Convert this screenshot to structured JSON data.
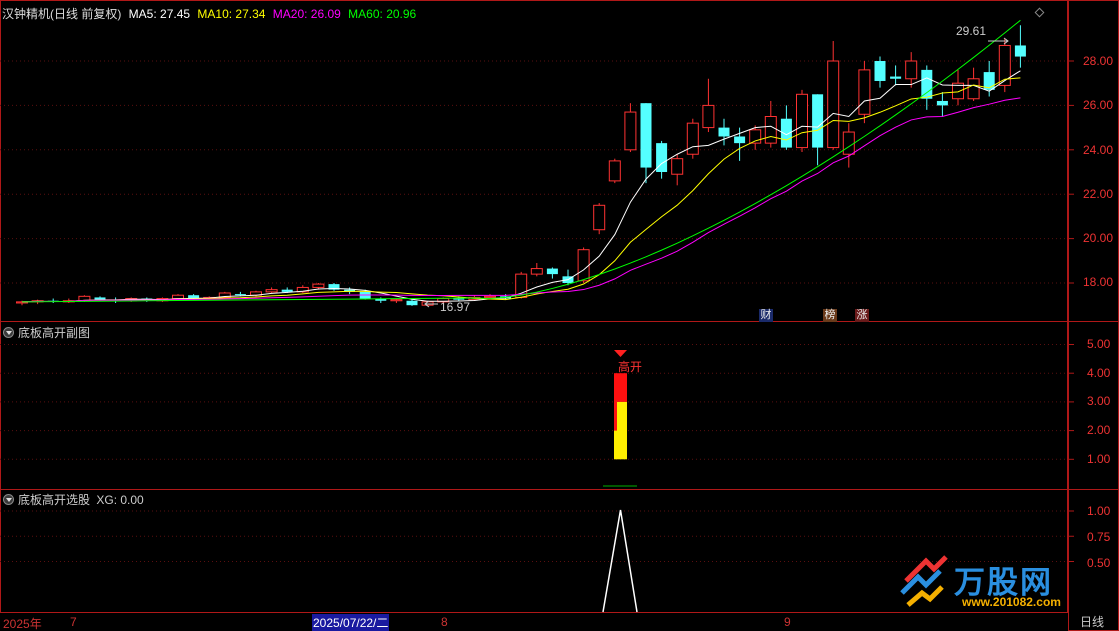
{
  "header": {
    "title": "汉钟精机(日线 前复权)",
    "ma5": "MA5: 27.45",
    "ma10": "MA10: 27.34",
    "ma20": "MA20: 26.09",
    "ma60": "MA60: 20.96"
  },
  "panel2": {
    "title": "底板高开副图",
    "signal_label": "高开"
  },
  "panel3": {
    "title": "底板高开选股",
    "xg": "XG: 0.00"
  },
  "annotations": {
    "high": "29.61",
    "low": "16.97"
  },
  "badges": {
    "cai": "财",
    "bang": "榜",
    "zhang": "涨"
  },
  "axis_main": [
    "28.00",
    "26.00",
    "24.00",
    "22.00",
    "20.00",
    "18.00"
  ],
  "axis_sub": [
    "5.00",
    "4.00",
    "3.00",
    "2.00",
    "1.00"
  ],
  "axis_xg": [
    "1.00",
    "0.75",
    "0.50"
  ],
  "dates": {
    "year": "2025年",
    "m7": "7",
    "sel": "2025/07/22/二",
    "m8": "8",
    "m9": "9",
    "period": "日线"
  },
  "watermark": {
    "brand": "万股网",
    "url": "www.201082.com"
  },
  "colors": {
    "up": "#ff3232",
    "down": "#54ffff",
    "ma5": "#ffffff",
    "ma10": "#ffff00",
    "ma20": "#ff00ff",
    "ma60": "#00ff00"
  },
  "icons": [
    "diamond-icon",
    "chevron-down-icon"
  ]
}
